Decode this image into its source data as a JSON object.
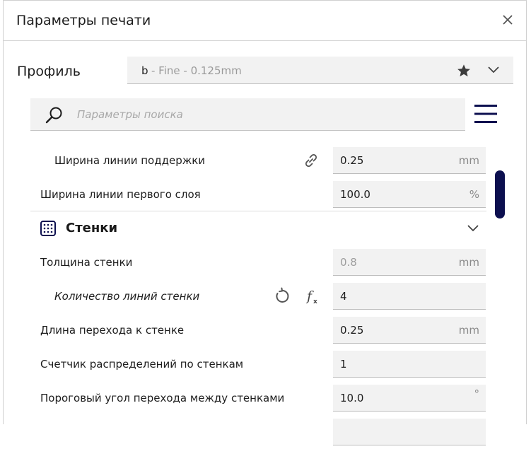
{
  "dialog": {
    "title": "Параметры печати"
  },
  "profile": {
    "label": "Профиль",
    "name": "b",
    "detail": "- Fine - 0.125mm"
  },
  "search": {
    "placeholder": "Параметры поиска"
  },
  "settings": {
    "support_line_width": {
      "label": "Ширина линии поддержки",
      "value": "0.25",
      "unit": "mm"
    },
    "initial_layer_line_width": {
      "label": "Ширина линии первого слоя",
      "value": "100.0",
      "unit": "%"
    },
    "walls_category": {
      "label": "Стенки"
    },
    "wall_thickness": {
      "label": "Толщина стенки",
      "value": "0.8",
      "unit": "mm"
    },
    "wall_line_count": {
      "label": "Количество линий стенки",
      "value": "4",
      "unit": ""
    },
    "wall_transition_length": {
      "label": "Длина перехода к стенке",
      "value": "0.25",
      "unit": "mm"
    },
    "wall_distribution_count": {
      "label": "Счетчик распределений по стенкам",
      "value": "1",
      "unit": ""
    },
    "wall_transition_angle": {
      "label": "Пороговый угол перехода между стенками",
      "value": "10.0",
      "unit": "°"
    }
  },
  "colors": {
    "accent": "#0c0f4f",
    "field_bg": "#f2f2f2",
    "muted_text": "#9d9d9d"
  },
  "icons": [
    "close-icon",
    "star-icon",
    "chevron-down-icon",
    "search-icon",
    "hamburger-menu-icon",
    "link-icon",
    "walls-category-icon",
    "reset-icon",
    "function-icon"
  ]
}
